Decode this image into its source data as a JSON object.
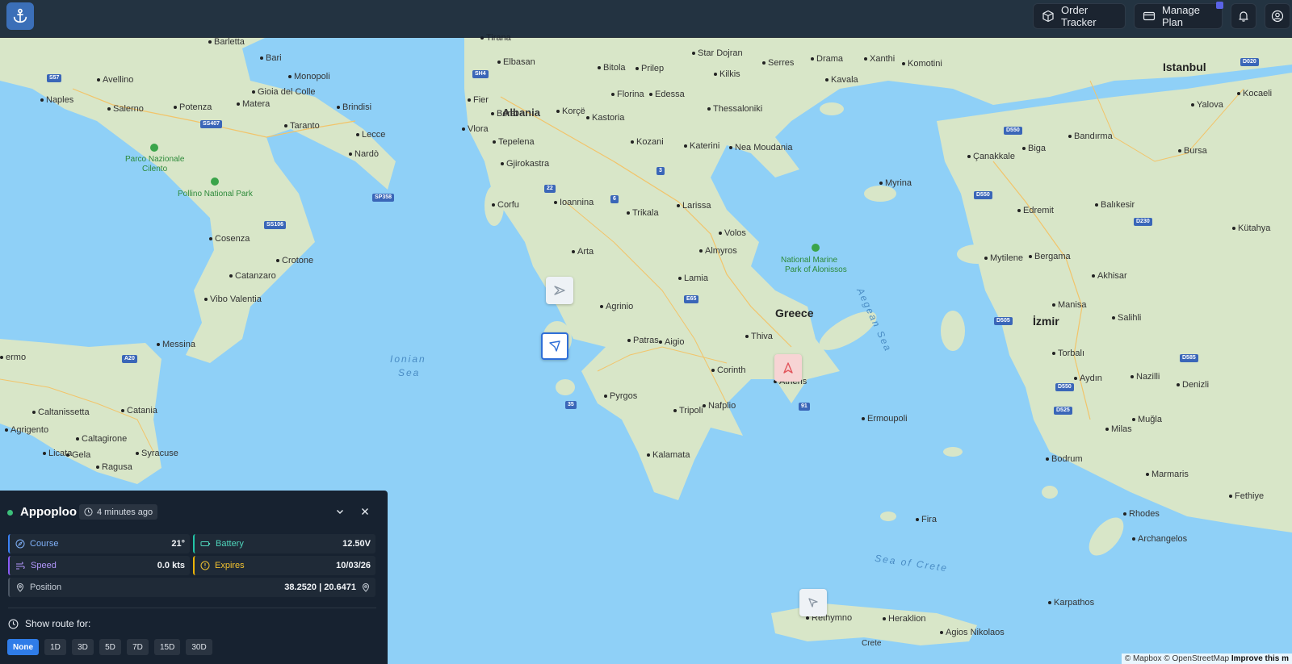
{
  "topbar": {
    "order_tracker_label": "Order Tracker",
    "manage_plan_label": "Manage Plan"
  },
  "map": {
    "countries": [
      {
        "id": "albania",
        "name": "Albania"
      },
      {
        "id": "greece",
        "name": "Greece"
      }
    ],
    "seas": [
      {
        "id": "ionian-1",
        "name": "Ionian"
      },
      {
        "id": "ionian-2",
        "name": "Sea"
      },
      {
        "id": "aegean",
        "name": "Aegean Sea"
      },
      {
        "id": "crete-sea",
        "name": "Sea of Crete"
      }
    ],
    "parks": [
      {
        "id": "cilento-1",
        "name": "Parco Nazionale"
      },
      {
        "id": "cilento-2",
        "name": "Cilento"
      },
      {
        "id": "pollino",
        "name": "Pollino National Park"
      },
      {
        "id": "alonissos-1",
        "name": "National Marine"
      },
      {
        "id": "alonissos-2",
        "name": "Park of Alonissos"
      }
    ],
    "big_cities": [
      {
        "id": "istanbul",
        "name": "Istanbul"
      },
      {
        "id": "izmir",
        "name": "İzmir"
      }
    ],
    "cities": [
      {
        "id": "naples",
        "name": "Naples"
      },
      {
        "id": "avellino",
        "name": "Avellino"
      },
      {
        "id": "barletta",
        "name": "Barletta"
      },
      {
        "id": "bari",
        "name": "Bari"
      },
      {
        "id": "monopoli",
        "name": "Monopoli"
      },
      {
        "id": "salerno",
        "name": "Salerno"
      },
      {
        "id": "potenza",
        "name": "Potenza"
      },
      {
        "id": "matera",
        "name": "Matera"
      },
      {
        "id": "gioia",
        "name": "Gioia del Colle"
      },
      {
        "id": "brindisi",
        "name": "Brindisi"
      },
      {
        "id": "taranto",
        "name": "Taranto"
      },
      {
        "id": "lecce",
        "name": "Lecce"
      },
      {
        "id": "nardo",
        "name": "Nardò"
      },
      {
        "id": "cosenza",
        "name": "Cosenza"
      },
      {
        "id": "crotone",
        "name": "Crotone"
      },
      {
        "id": "catanzaro",
        "name": "Catanzaro"
      },
      {
        "id": "vibo",
        "name": "Vibo Valentia"
      },
      {
        "id": "messina",
        "name": "Messina"
      },
      {
        "id": "palermo",
        "name": "ermo"
      },
      {
        "id": "caltanissetta",
        "name": "Caltanissetta"
      },
      {
        "id": "catania",
        "name": "Catania"
      },
      {
        "id": "agrigento",
        "name": "Agrigento"
      },
      {
        "id": "caltagirone",
        "name": "Caltagirone"
      },
      {
        "id": "licata",
        "name": "Licata"
      },
      {
        "id": "gela",
        "name": "Gela"
      },
      {
        "id": "syracuse",
        "name": "Syracuse"
      },
      {
        "id": "ragusa",
        "name": "Ragusa"
      },
      {
        "id": "tirana",
        "name": "Tirana"
      },
      {
        "id": "elbasan",
        "name": "Elbasan"
      },
      {
        "id": "fier",
        "name": "Fier"
      },
      {
        "id": "berat",
        "name": "Berat"
      },
      {
        "id": "vlora",
        "name": "Vlora"
      },
      {
        "id": "korce",
        "name": "Korçë"
      },
      {
        "id": "tepelena",
        "name": "Tepelena"
      },
      {
        "id": "gjirokastra",
        "name": "Gjirokastra"
      },
      {
        "id": "bitola",
        "name": "Bitola"
      },
      {
        "id": "prilep",
        "name": "Prilep"
      },
      {
        "id": "florina",
        "name": "Florina"
      },
      {
        "id": "kastoria",
        "name": "Kastoria"
      },
      {
        "id": "kozani",
        "name": "Kozani"
      },
      {
        "id": "edessa",
        "name": "Edessa"
      },
      {
        "id": "thessaloniki",
        "name": "Thessaloniki"
      },
      {
        "id": "katerini",
        "name": "Katerini"
      },
      {
        "id": "nea-moudania",
        "name": "Nea Moudania"
      },
      {
        "id": "star-dojran",
        "name": "Star Dojran"
      },
      {
        "id": "serres",
        "name": "Serres"
      },
      {
        "id": "kilkis",
        "name": "Kilkis"
      },
      {
        "id": "drama",
        "name": "Drama"
      },
      {
        "id": "xanthi",
        "name": "Xanthi"
      },
      {
        "id": "komotini",
        "name": "Komotini"
      },
      {
        "id": "kavala",
        "name": "Kavala"
      },
      {
        "id": "corfu",
        "name": "Corfu"
      },
      {
        "id": "ioannina",
        "name": "Ioannina"
      },
      {
        "id": "trikala",
        "name": "Trikala"
      },
      {
        "id": "larissa",
        "name": "Larissa"
      },
      {
        "id": "volos",
        "name": "Volos"
      },
      {
        "id": "almyros",
        "name": "Almyros"
      },
      {
        "id": "arta",
        "name": "Arta"
      },
      {
        "id": "lamia",
        "name": "Lamia"
      },
      {
        "id": "agrinio",
        "name": "Agrinio"
      },
      {
        "id": "patras",
        "name": "Patras"
      },
      {
        "id": "aigio",
        "name": "Aigio"
      },
      {
        "id": "thiva",
        "name": "Thiva"
      },
      {
        "id": "corinth",
        "name": "Corinth"
      },
      {
        "id": "athens",
        "name": "Athens"
      },
      {
        "id": "pyrgos",
        "name": "Pyrgos"
      },
      {
        "id": "tripoli",
        "name": "Tripoli"
      },
      {
        "id": "nafplio",
        "name": "Nafplio"
      },
      {
        "id": "kalamata",
        "name": "Kalamata"
      },
      {
        "id": "ermoupoli",
        "name": "Ermoupoli"
      },
      {
        "id": "myrina",
        "name": "Myrina"
      },
      {
        "id": "mytilene",
        "name": "Mytilene"
      },
      {
        "id": "canakkale",
        "name": "Çanakkale"
      },
      {
        "id": "biga",
        "name": "Biga"
      },
      {
        "id": "bandirma",
        "name": "Bandırma"
      },
      {
        "id": "bursa",
        "name": "Bursa"
      },
      {
        "id": "yalova",
        "name": "Yalova"
      },
      {
        "id": "kocaeli",
        "name": "Kocaeli"
      },
      {
        "id": "edremit",
        "name": "Edremit"
      },
      {
        "id": "balikesir",
        "name": "Balıkesir"
      },
      {
        "id": "kutahya",
        "name": "Kütahya"
      },
      {
        "id": "bergama",
        "name": "Bergama"
      },
      {
        "id": "akhisar",
        "name": "Akhisar"
      },
      {
        "id": "manisa",
        "name": "Manisa"
      },
      {
        "id": "salihli",
        "name": "Salihli"
      },
      {
        "id": "torbali",
        "name": "Torbalı"
      },
      {
        "id": "aydin",
        "name": "Aydın"
      },
      {
        "id": "nazilli",
        "name": "Nazilli"
      },
      {
        "id": "denizli",
        "name": "Denizli"
      },
      {
        "id": "milas",
        "name": "Milas"
      },
      {
        "id": "mugla",
        "name": "Muğla"
      },
      {
        "id": "bodrum",
        "name": "Bodrum"
      },
      {
        "id": "marmaris",
        "name": "Marmaris"
      },
      {
        "id": "fethiye",
        "name": "Fethiye"
      },
      {
        "id": "rhodes",
        "name": "Rhodes"
      },
      {
        "id": "archangelos",
        "name": "Archangelos"
      },
      {
        "id": "karpathos",
        "name": "Karpathos"
      },
      {
        "id": "fira",
        "name": "Fira"
      },
      {
        "id": "rethymno",
        "name": "Rethymno"
      },
      {
        "id": "heraklion",
        "name": "Heraklion"
      },
      {
        "id": "agios-nikolaos",
        "name": "Agios Nikolaos"
      },
      {
        "id": "crete",
        "name": "Crete"
      }
    ],
    "roads": [
      {
        "id": "s57",
        "name": "S57"
      },
      {
        "id": "ss407",
        "name": "SS407"
      },
      {
        "id": "sp358",
        "name": "SP358"
      },
      {
        "id": "ss106",
        "name": "SS106"
      },
      {
        "id": "a20",
        "name": "A20"
      },
      {
        "id": "sh4",
        "name": "SH4"
      },
      {
        "id": "r22",
        "name": "22"
      },
      {
        "id": "r3",
        "name": "3"
      },
      {
        "id": "r6",
        "name": "6"
      },
      {
        "id": "e65",
        "name": "E65"
      },
      {
        "id": "r35",
        "name": "35"
      },
      {
        "id": "r91",
        "name": "91"
      },
      {
        "id": "d020",
        "name": "D020"
      },
      {
        "id": "d550a",
        "name": "D550"
      },
      {
        "id": "d550b",
        "name": "D550"
      },
      {
        "id": "d230",
        "name": "D230"
      },
      {
        "id": "d505",
        "name": "D505"
      },
      {
        "id": "d585",
        "name": "D585"
      },
      {
        "id": "d550c",
        "name": "D550"
      },
      {
        "id": "d525",
        "name": "D525"
      }
    ],
    "attribution_text": "© Mapbox © OpenStreetMap",
    "attribution_link": "Improve this m"
  },
  "panel": {
    "vessel_name": "Appoploo",
    "last_seen": "4 minutes ago",
    "course_label": "Course",
    "course_value": "21°",
    "battery_label": "Battery",
    "battery_value": "12.50V",
    "speed_label": "Speed",
    "speed_value": "0.0 kts",
    "expires_label": "Expires",
    "expires_value": "10/03/26",
    "position_label": "Position",
    "position_value": "38.2520 | 20.6471",
    "route_title": "Show route for:",
    "route_options": [
      "None",
      "1D",
      "3D",
      "5D",
      "7D",
      "15D",
      "30D"
    ],
    "route_selected": "None"
  },
  "colors": {
    "accent": "#2f7ce8",
    "online": "#3cc07a",
    "course": "#3b82f6",
    "battery": "#22c3a6",
    "speed": "#8b5cf6",
    "expires": "#eab308"
  }
}
